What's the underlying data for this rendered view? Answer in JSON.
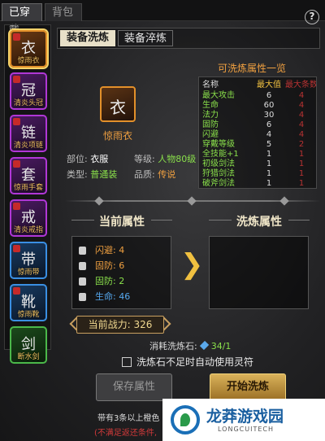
{
  "top_tabs": {
    "equipped": "已穿戴",
    "bag": "背包"
  },
  "help": "?",
  "left_items": [
    {
      "name": "惊雨衣",
      "glyph": "衣",
      "rarity": "orange",
      "selected": true
    },
    {
      "name": "清炎头冠",
      "glyph": "冠",
      "rarity": "purple"
    },
    {
      "name": "清炎项链",
      "glyph": "链",
      "rarity": "purple"
    },
    {
      "name": "惊雨手套",
      "glyph": "套",
      "rarity": "purple"
    },
    {
      "name": "清炎戒指",
      "glyph": "戒",
      "rarity": "purple"
    },
    {
      "name": "惊雨带",
      "glyph": "带",
      "rarity": "blue"
    },
    {
      "name": "惊雨靴",
      "glyph": "靴",
      "rarity": "blue"
    },
    {
      "name": "断水剑",
      "glyph": "剑",
      "rarity": "green"
    }
  ],
  "sub_tabs": {
    "wash": "装备洗炼",
    "quench": "装备淬炼"
  },
  "equipment": {
    "name": "惊雨衣",
    "slot_label": "部位:",
    "slot_value": "衣服",
    "level_label": "等级:",
    "level_value": "人物80级",
    "type_label": "类型:",
    "type_value": "普通装",
    "quality_label": "品质:",
    "quality_value": "传说"
  },
  "attr_list": {
    "title": "可洗炼属性一览",
    "headers": {
      "name": "名称",
      "max": "最大值",
      "extra": "最大条数"
    },
    "rows": [
      {
        "name": "最大攻击",
        "max": "6",
        "extra": "4"
      },
      {
        "name": "生命",
        "max": "60",
        "extra": "4"
      },
      {
        "name": "法力",
        "max": "30",
        "extra": "4"
      },
      {
        "name": "固防",
        "max": "6",
        "extra": "4"
      },
      {
        "name": "闪避",
        "max": "4",
        "extra": "4"
      },
      {
        "name": "穿戴等级",
        "max": "5",
        "extra": "2"
      },
      {
        "name": "全技能+1",
        "max": "1",
        "extra": "1"
      },
      {
        "name": "初级剑法",
        "max": "1",
        "extra": "1"
      },
      {
        "name": "狩猎剑法",
        "max": "1",
        "extra": "1"
      },
      {
        "name": "破斧剑法",
        "max": "1",
        "extra": "1"
      }
    ]
  },
  "current_title": "当前属性",
  "new_title": "洗炼属性",
  "current_attrs": [
    {
      "text": "闪避: 4",
      "color": "orange"
    },
    {
      "text": "固防: 6",
      "color": "orange"
    },
    {
      "text": "固防: 2",
      "color": "green"
    },
    {
      "text": "生命: 46",
      "color": "blue"
    }
  ],
  "arrow": "❯",
  "power": "当前战力: 326",
  "cost": {
    "label": "消耗洗炼石:",
    "count": "34/1"
  },
  "auto_use": "洗炼石不足时自动使用灵符",
  "buttons": {
    "save": "保存属性",
    "start": "开始洗炼"
  },
  "note1": "带有3条以上橙色",
  "note2": "(不满足返还条件,",
  "watermark": {
    "title": "龙莽游戏园",
    "sub": "LONGCUITECH"
  }
}
